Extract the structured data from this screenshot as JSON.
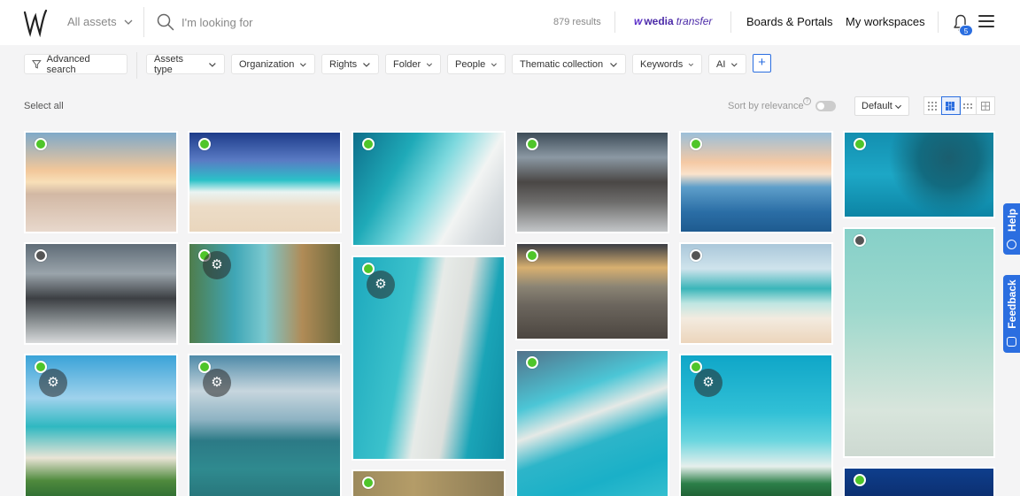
{
  "header": {
    "scope": "All assets",
    "search_placeholder": "I'm looking for",
    "results": "879 results",
    "brand_prefix": "wedia",
    "brand_suffix": "transfer",
    "boards": "Boards & Portals",
    "workspaces": "My workspaces",
    "notification_count": "5"
  },
  "filters": {
    "advanced": "Advanced search",
    "items": [
      "Assets type",
      "Organization",
      "Rights",
      "Folder",
      "People",
      "Thematic collection",
      "Keywords",
      "AI"
    ],
    "add": "+"
  },
  "toolbar": {
    "select_all": "Select all",
    "sort": "Sort by relevance",
    "sort_help": "?",
    "order": "Default"
  },
  "side_tabs": {
    "help": "Help",
    "feedback": "Feedback"
  },
  "icons": {
    "logo": "wedia-logo-icon",
    "search": "search-icon",
    "bell": "bell-icon",
    "menu": "hamburger-menu-icon",
    "gear": "gear-icon",
    "chevron": "chevron-down-icon"
  },
  "colors": {
    "accent": "#2b6ee0",
    "status_active": "#4fc52a",
    "status_inactive": "#555555",
    "brand": "#5b2fc9"
  },
  "assets": [
    {
      "status": "active",
      "gear": false,
      "subject": "beach sunset"
    },
    {
      "status": "active",
      "gear": false,
      "subject": "turquoise wave beach"
    },
    {
      "status": "active",
      "gear": false,
      "subject": "aerial coast road"
    },
    {
      "status": "active",
      "gear": false,
      "subject": "misty mountains"
    },
    {
      "status": "active",
      "gear": false,
      "subject": "cliff sunset sea"
    },
    {
      "status": "active",
      "gear": false,
      "subject": "aerial reef"
    },
    {
      "status": "inactive",
      "gear": false,
      "subject": "cloudy mountains"
    },
    {
      "status": "active",
      "gear": true,
      "subject": "coastal bay"
    },
    {
      "status": "active",
      "gear": true,
      "subject": "aerial lagoon pier"
    },
    {
      "status": "active",
      "gear": false,
      "subject": "wooden pier sunset"
    },
    {
      "status": "inactive",
      "gear": false,
      "subject": "shoreline waves"
    },
    {
      "status": "inactive",
      "gear": false,
      "subject": "starfish shallow water"
    },
    {
      "status": "active",
      "gear": true,
      "subject": "palm island"
    },
    {
      "status": "active",
      "gear": true,
      "subject": "island lagoon"
    },
    {
      "status": "active",
      "gear": false,
      "subject": "aerial resort"
    },
    {
      "status": "active",
      "gear": true,
      "subject": "turquoise reef"
    },
    {
      "status": "active",
      "gear": false,
      "subject": "sand texture"
    },
    {
      "status": "active",
      "gear": true,
      "subject": "deep blue water"
    }
  ]
}
